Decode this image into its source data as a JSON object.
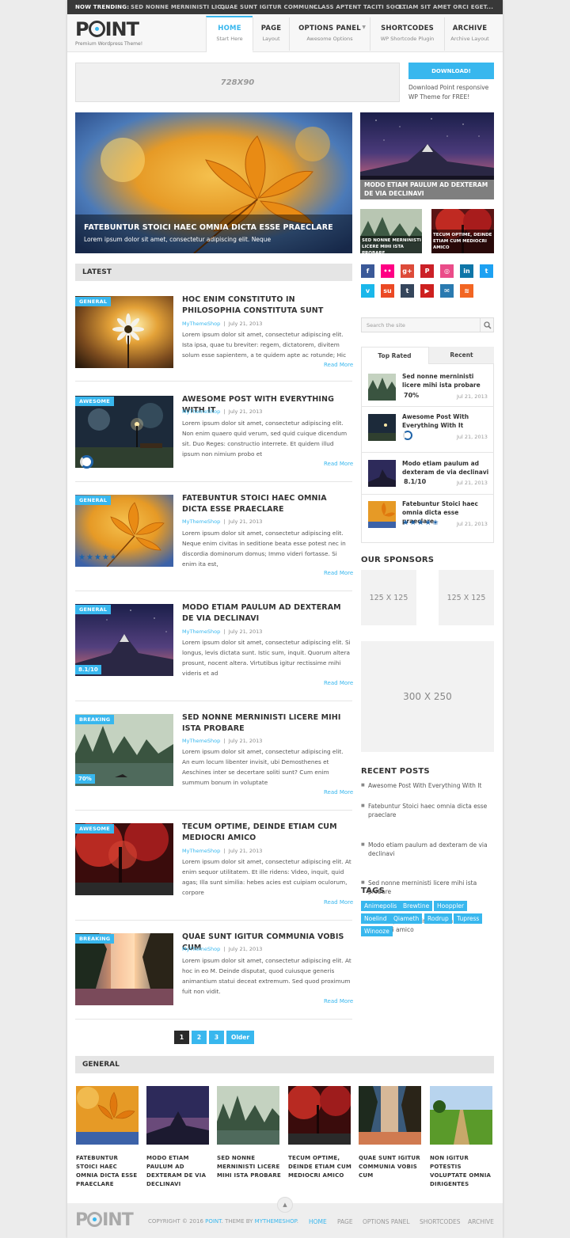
{
  "trending": {
    "label": "NOW TRENDING:",
    "items": [
      "SED NONNE MERNINISTI LIC...",
      "QUAE SUNT IGITUR COMMUNI...",
      "CLASS APTENT TACITI SOCI...",
      "ETIAM SIT AMET ORCI EGET..."
    ]
  },
  "logo": {
    "pre": "P",
    "post": "INT",
    "tagline": "Premium Wordpress Theme!"
  },
  "nav": [
    {
      "title": "HOME",
      "sub": "Start Here"
    },
    {
      "title": "PAGE",
      "sub": "Layout"
    },
    {
      "title": "OPTIONS PANEL",
      "sub": "Awesome Options"
    },
    {
      "title": "SHORTCODES",
      "sub": "WP Shortcode Plugin"
    },
    {
      "title": "ARCHIVE",
      "sub": "Archive Layout"
    }
  ],
  "ad_728": "728X90",
  "download": {
    "button": "DOWNLOAD!",
    "text": "Download Point responsive WP Theme for FREE!"
  },
  "featured": {
    "main_title": "FATEBUNTUR STOICI HAEC OMNIA DICTA ESSE PRAECLARE",
    "main_excerpt": "Lorem ipsum dolor sit amet, consectetur adipiscing elit. Neque",
    "side_title": "MODO ETIAM PAULUM AD DEXTERAM DE VIA DECLINAVI",
    "small1": "SED NONNE MERNINISTI LICERE MIHI ISTA PROBARE",
    "small2": "TECUM OPTIME, DEINDE ETIAM CUM MEDIOCRI AMICO"
  },
  "latest_heading": "LATEST",
  "posts": [
    {
      "badge": "GENERAL",
      "title": "HOC ENIM CONSTITUTO IN PHILOSOPHIA CONSTITUTA SUNT",
      "author": "MyThemeShop",
      "date": "July 21, 2013",
      "excerpt": "Lorem ipsum dolor sit amet, consectetur adipiscing elit. Ista ipsa, quae tu breviter: regem, dictatorem, divitem solum esse sapientem, a te quidem apte ac rotunde; Hic ego: Etsi",
      "more": "Read More"
    },
    {
      "badge": "AWESOME",
      "title": "AWESOME POST WITH EVERYTHING WITH IT",
      "author": "MyThemeShop",
      "date": "July 21, 2013",
      "excerpt": "Lorem ipsum dolor sit amet, consectetur adipiscing elit. Non enim quaero quid verum, sed quid cuique dicendum sit. Duo Reges: constructio interrete. Et quidem illud ipsum non nimium probo et",
      "more": "Read More"
    },
    {
      "badge": "GENERAL",
      "title": "FATEBUNTUR STOICI HAEC OMNIA DICTA ESSE PRAECLARE",
      "author": "MyThemeShop",
      "date": "July 21, 2013",
      "excerpt": "Lorem ipsum dolor sit amet, consectetur adipiscing elit. Neque enim civitas in seditione beata esse potest nec in discordia dominorum domus; Immo videri fortasse. Si enim ita est,",
      "more": "Read More"
    },
    {
      "badge": "GENERAL",
      "title": "MODO ETIAM PAULUM AD DEXTERAM DE VIA DECLINAVI",
      "author": "MyThemeShop",
      "date": "July 21, 2013",
      "excerpt": "Lorem ipsum dolor sit amet, consectetur adipiscing elit. Si longus, levis dictata sunt. Istic sum, inquit. Quorum altera prosunt, nocent altera. Virtutibus igitur rectissime mihi videris et ad",
      "more": "Read More",
      "rating": "8.1/10"
    },
    {
      "badge": "BREAKING",
      "title": "SED NONNE MERNINISTI LICERE MIHI ISTA PROBARE",
      "author": "MyThemeShop",
      "date": "July 21, 2013",
      "excerpt": "Lorem ipsum dolor sit amet, consectetur adipiscing elit. An eum locum libenter invisit, ubi Demosthenes et Aeschines inter se decertare soliti sunt? Cum enim summum bonum in voluptate",
      "more": "Read More",
      "rating": "70%"
    },
    {
      "badge": "AWESOME",
      "title": "TECUM OPTIME, DEINDE ETIAM CUM MEDIOCRI AMICO",
      "author": "MyThemeShop",
      "date": "July 21, 2013",
      "excerpt": "Lorem ipsum dolor sit amet, consectetur adipiscing elit. At enim sequor utilitatem. Et ille ridens: Video, inquit, quid agas; Illa sunt similia: hebes acies est cuipiam oculorum, corpore",
      "more": "Read More"
    },
    {
      "badge": "BREAKING",
      "title": "QUAE SUNT IGITUR COMMUNIA VOBIS CUM",
      "author": "MyThemeShop",
      "date": "July 21, 2013",
      "excerpt": "Lorem ipsum dolor sit amet, consectetur adipiscing elit. At hoc in eo M. Deinde disputat, quod cuiusque generis animantium statui deceat extremum. Sed quod proximum fuit non vidit.",
      "more": "Read More"
    }
  ],
  "pagination": [
    "1",
    "2",
    "3",
    "Older"
  ],
  "search_placeholder": "Search the site",
  "tabs": {
    "top": "Top Rated",
    "recent": "Recent"
  },
  "widget": [
    {
      "title": "Sed nonne merninisti licere mihi ista probare",
      "score": "70%",
      "date": "Jul 21, 2013"
    },
    {
      "title": "Awesome Post With Everything With It",
      "date": "Jul 21, 2013"
    },
    {
      "title": "Modo etiam paulum ad dexteram de via declinavi",
      "score": "8.1/10",
      "date": "Jul 21, 2013"
    },
    {
      "title": "Fatebuntur Stoici haec omnia dicta esse praeclare",
      "date": "Jul 21, 2013"
    }
  ],
  "sponsors": {
    "heading": "OUR SPONSORS",
    "s1": "125 X 125",
    "s2": "125 X 125",
    "big": "300 X 250"
  },
  "recent_posts": {
    "heading": "RECENT POSTS",
    "items": [
      "Awesome Post With Everything With It",
      "Fatebuntur Stoici haec omnia dicta esse praeclare",
      "Modo etiam paulum ad dexteram de via declinavi",
      "Sed nonne merninisti licere mihi ista probare",
      "Tecum optime, deinde etiam cum mediocri amico"
    ]
  },
  "tags": {
    "heading": "TAGS",
    "items": [
      "Animepolis",
      "Brewtine",
      "Hooppler",
      "Noelind",
      "Qiameth",
      "Rodrup",
      "Tupress",
      "Winooze"
    ]
  },
  "general": {
    "heading": "GENERAL",
    "items": [
      "FATEBUNTUR STOICI HAEC OMNIA DICTA ESSE PRAECLARE",
      "MODO ETIAM PAULUM AD DEXTERAM DE VIA DECLINAVI",
      "SED NONNE MERNINISTI LICERE MIHI ISTA PROBARE",
      "TECUM OPTIME, DEINDE ETIAM CUM MEDIOCRI AMICO",
      "QUAE SUNT IGITUR COMMUNIA VOBIS CUM",
      "NON IGITUR POTESTIS VOLUPTATE OMNIA DIRIGENTES"
    ]
  },
  "footer": {
    "copy_pre": "COPYRIGHT © 2016",
    "copy_point": "POINT",
    "copy_mid": ". THEME BY",
    "copy_mts": "MYTHEMESHOP",
    "links": [
      "HOME",
      "PAGE",
      "OPTIONS PANEL",
      "SHORTCODES",
      "ARCHIVE"
    ]
  },
  "colors": {
    "accent": "#38b7ee",
    "dark": "#383838"
  }
}
